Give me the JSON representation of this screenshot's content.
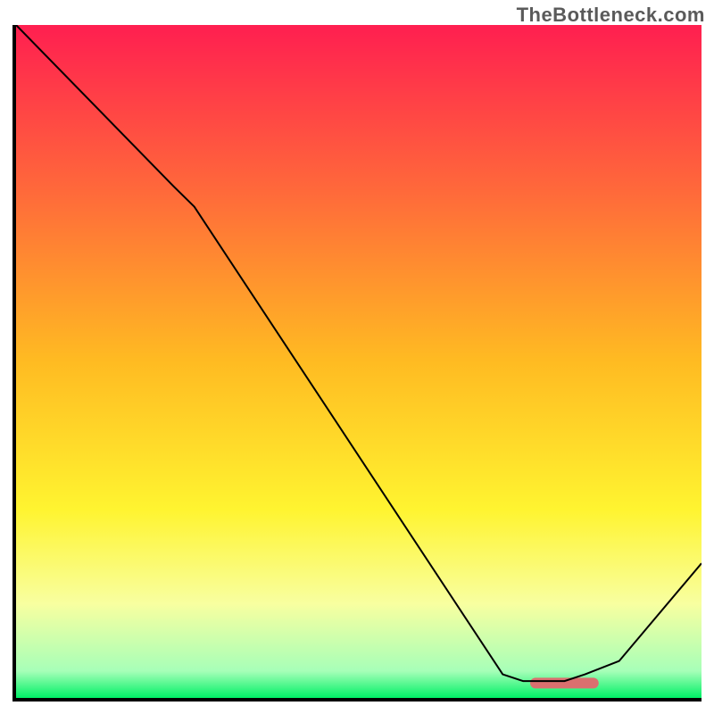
{
  "watermark": "TheBottleneck.com",
  "chart_data": {
    "type": "line",
    "title": "",
    "xlabel": "",
    "ylabel": "",
    "xlim": [
      0,
      100
    ],
    "ylim": [
      0,
      100
    ],
    "series": [
      {
        "name": "curve",
        "x": [
          0,
          23,
          26,
          71,
          74,
          80,
          83,
          88,
          100
        ],
        "values": [
          100,
          76,
          73,
          3.5,
          2.5,
          2.5,
          3.5,
          5.5,
          20
        ],
        "color": "#000000",
        "width": 2
      }
    ],
    "marker": {
      "x_center": 80,
      "x_halfwidth": 5,
      "y": 2.2,
      "color": "#da6f6f",
      "thickness": 12
    },
    "background": {
      "gradient_stops": [
        {
          "pct": 0,
          "color": "#ff1f50"
        },
        {
          "pct": 25,
          "color": "#ff6a3a"
        },
        {
          "pct": 50,
          "color": "#ffbb22"
        },
        {
          "pct": 72,
          "color": "#fff430"
        },
        {
          "pct": 86,
          "color": "#f8ffa0"
        },
        {
          "pct": 96,
          "color": "#a7ffb8"
        },
        {
          "pct": 100,
          "color": "#00f066"
        }
      ]
    },
    "axes": {
      "color": "#000000",
      "width": 4
    }
  }
}
